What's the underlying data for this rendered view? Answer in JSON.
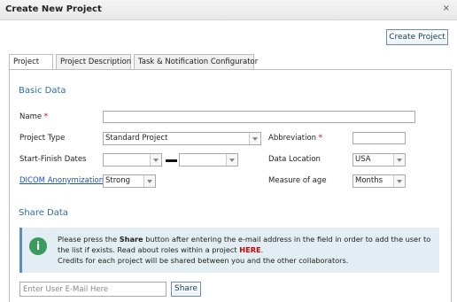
{
  "window": {
    "title": "Create New Project",
    "close_glyph": "×"
  },
  "toolbar": {
    "create_label": "Create Project"
  },
  "tabs": [
    {
      "label": "Project",
      "active": true
    },
    {
      "label": "Project Description",
      "active": false
    },
    {
      "label": "Task & Notification Configurator",
      "active": false
    }
  ],
  "basic": {
    "heading": "Basic Data",
    "name_label": "Name",
    "required_mark": "*",
    "project_type_label": "Project Type",
    "project_type_value": "Standard Project",
    "abbreviation_label": "Abbreviation",
    "dates_label": "Start-Finish Dates",
    "location_label": "Data Location",
    "location_value": "USA",
    "dicom_label": "DICOM Anonymization",
    "dicom_value": "Strong",
    "age_label": "Measure of age",
    "age_value": "Months"
  },
  "share": {
    "heading": "Share Data",
    "info_pre": "Please press the ",
    "info_bold": "Share",
    "info_mid": " button after entering the e-mail address in the field in order to add the user to the list if exists. Read about roles within a project ",
    "info_link": "HERE",
    "info_end": ".",
    "info_line2": "Credits for each project will be shared between you and the other collaborators.",
    "email_placeholder": "Enter User E-Mail Here",
    "share_label": "Share"
  },
  "colors": {
    "accent": "#2d6ea8",
    "info_bg": "#e2edf4",
    "info_icon": "#3c9a5f",
    "required": "#cc0000",
    "link": "#1a4fc4"
  },
  "icons": {
    "info": "info-icon",
    "close": "close-icon",
    "dropdown": "chevron-down-icon"
  }
}
